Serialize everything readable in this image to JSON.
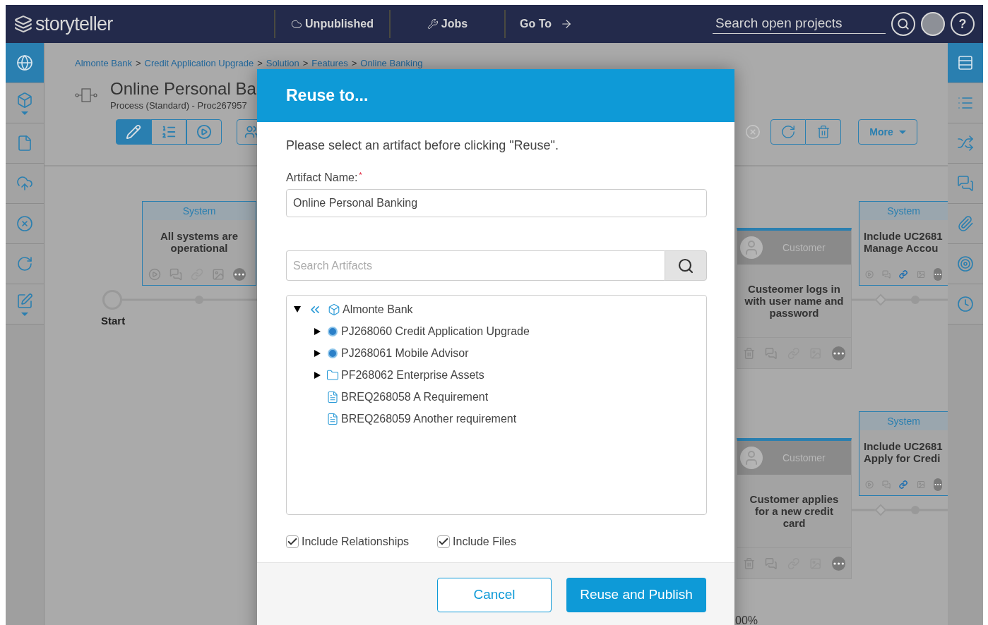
{
  "header": {
    "logo": "storyteller",
    "nav": [
      {
        "kind": "publish",
        "label": "Unpublished"
      },
      {
        "kind": "jobs",
        "label": "Jobs"
      },
      {
        "kind": "goto",
        "label": "Go To"
      }
    ],
    "search": {
      "placeholder": "Search open projects"
    },
    "help": "?"
  },
  "left_sidebar": {
    "items": [
      {
        "selected": true
      },
      {
        "selected": false
      },
      {
        "selected": false
      },
      {
        "selected": false
      },
      {
        "selected": false
      },
      {
        "selected": false
      },
      {
        "selected": false
      }
    ]
  },
  "right_sidebar": {
    "items": [
      {
        "selected": true
      },
      {
        "selected": false
      },
      {
        "selected": false
      },
      {
        "selected": false
      },
      {
        "selected": false
      },
      {
        "selected": false
      },
      {
        "selected": false
      }
    ]
  },
  "breadcrumb": {
    "separator": ">",
    "items": [
      "Almonte Bank",
      "Credit Application Upgrade",
      "Solution",
      "Features",
      "Online Banking"
    ]
  },
  "artifact": {
    "title": "Online Personal Ba",
    "subtitle": "Process (Standard) - Proc267957"
  },
  "toolbar": {
    "view_modes": [
      {
        "selected": true
      },
      {
        "selected": false
      },
      {
        "selected": false
      }
    ],
    "more": "More"
  },
  "canvas": {
    "start_label": "Start",
    "zoom": "00%",
    "system_cards": [
      {
        "header": "System",
        "lines": [
          "All systems are",
          "operational"
        ],
        "linked": false
      },
      {
        "header": "System",
        "lines": [
          "Include UC2681",
          "Manage Accou"
        ],
        "linked": true
      },
      {
        "header": "System",
        "lines": [
          "Include UC2681",
          "Apply for Credi"
        ],
        "linked": true
      }
    ],
    "customer_cards": [
      {
        "header": "Customer",
        "text": "Custeomer logs in with user name and password"
      },
      {
        "header": "Customer",
        "text": "Customer applies for a new credit card"
      }
    ]
  },
  "dialog": {
    "title": "Reuse to...",
    "instruction": "Please select an artifact before clicking \"Reuse\".",
    "field_label": "Artifact Name:",
    "required_mark": "*",
    "field_value": "Online Personal Banking",
    "search_placeholder": "Search Artifacts",
    "tree": [
      {
        "kind": "root",
        "label": "Almonte Bank",
        "expanded": true,
        "children": [
          {
            "kind": "project",
            "label": "PJ268060 Credit Application Upgrade",
            "expanded": false
          },
          {
            "kind": "project",
            "label": "PJ268061 Mobile Advisor",
            "expanded": false
          },
          {
            "kind": "folder",
            "label": "PF268062 Enterprise Assets",
            "expanded": false
          },
          {
            "kind": "requirement",
            "label": "BREQ268058 A Requirement"
          },
          {
            "kind": "requirement",
            "label": "BREQ268059 Another requirement"
          }
        ]
      }
    ],
    "options": [
      {
        "label": "Include Relationships",
        "checked": true
      },
      {
        "label": "Include Files",
        "checked": true
      }
    ],
    "buttons": [
      {
        "kind": "secondary",
        "label": "Cancel"
      },
      {
        "kind": "primary",
        "label": "Reuse and Publish"
      }
    ]
  }
}
